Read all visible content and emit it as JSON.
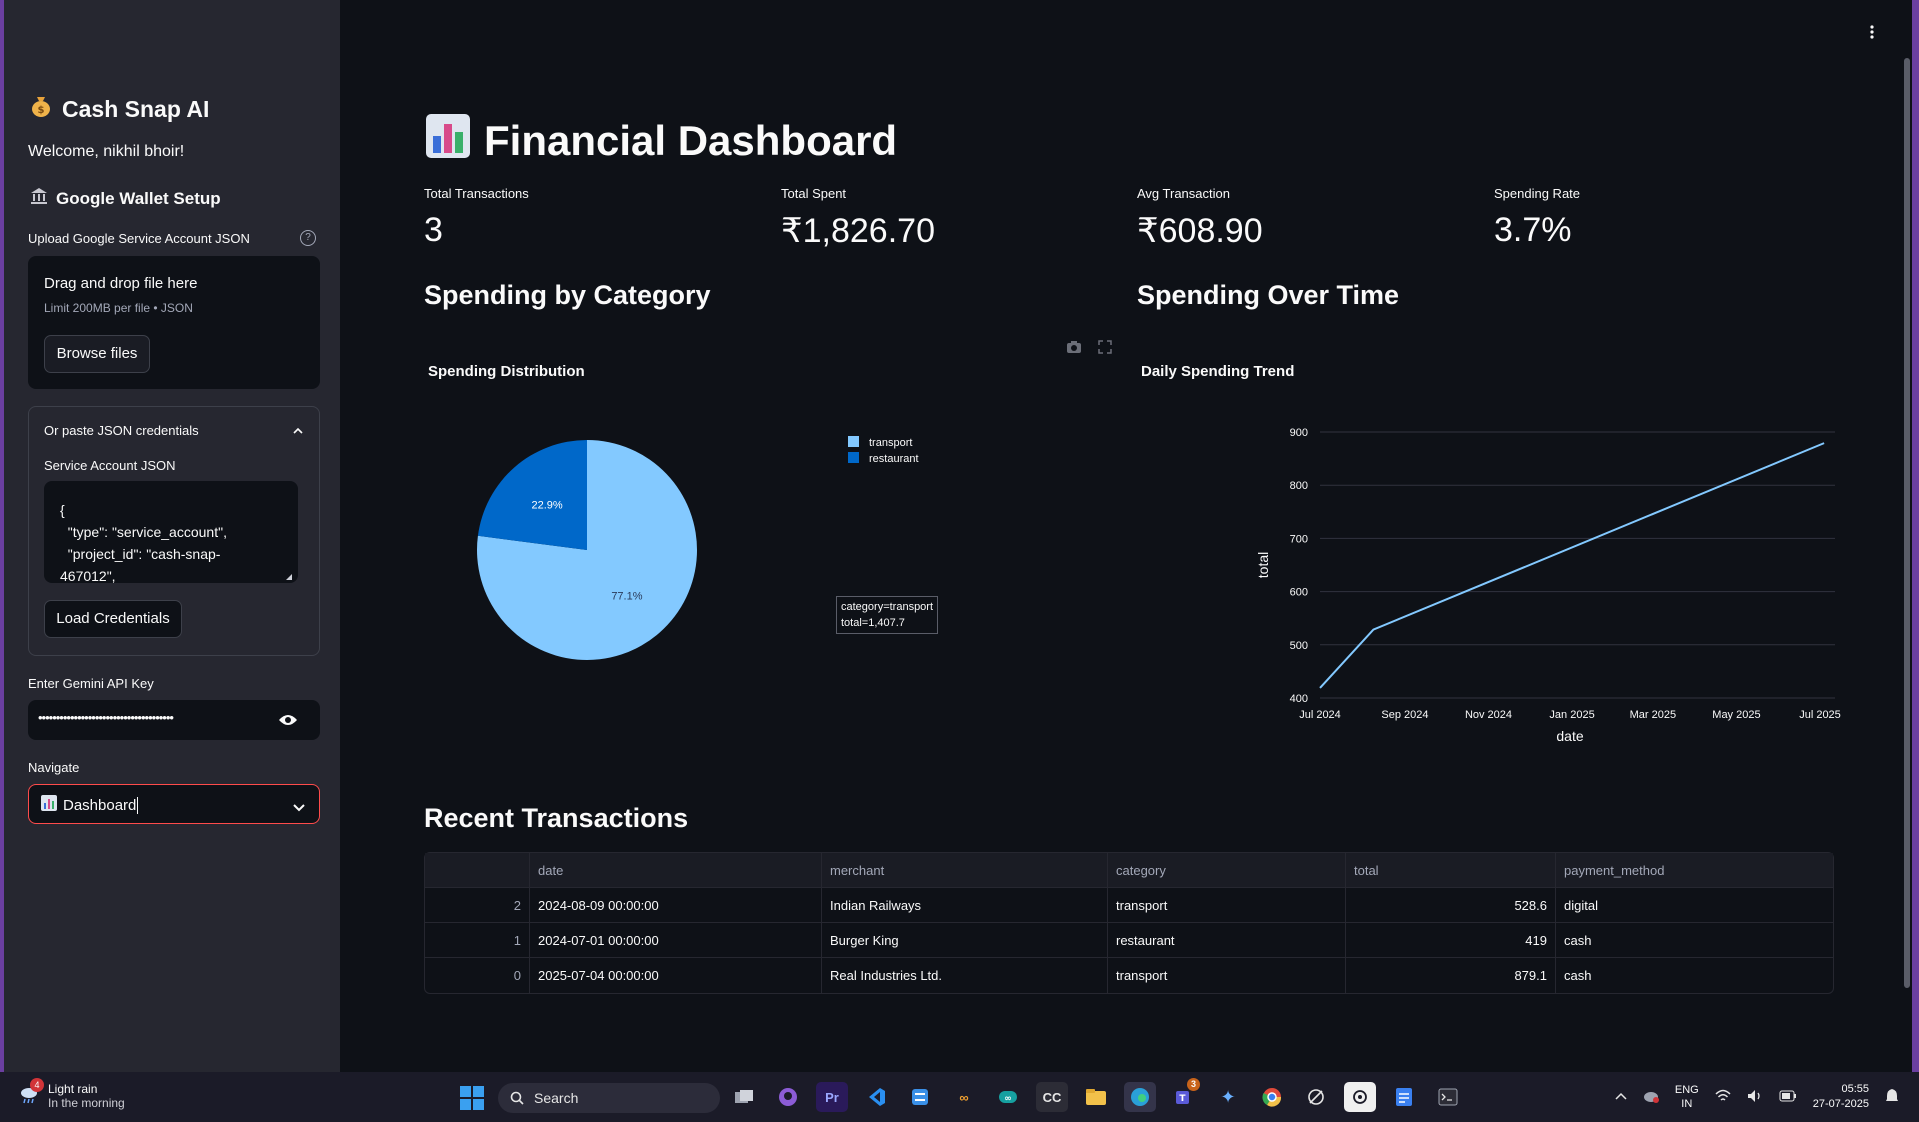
{
  "sidebar": {
    "title": "Cash Snap AI",
    "welcome": "Welcome, nikhil bhoir!",
    "wallet_heading": "Google Wallet Setup",
    "upload_label": "Upload Google Service Account JSON",
    "dropzone_title": "Drag and drop file here",
    "dropzone_limit": "Limit 200MB per file • JSON",
    "browse_label": "Browse files",
    "expander_label": "Or paste JSON credentials",
    "json_label": "Service Account JSON",
    "json_value": "{\n  \"type\": \"service_account\",\n  \"project_id\": \"cash-snap-\n467012\",",
    "load_label": "Load Credentials",
    "api_label": "Enter Gemini API Key",
    "api_value": "••••••••••••••••••••••••••••••••••••••",
    "nav_label": "Navigate",
    "nav_value": "Dashboard"
  },
  "main": {
    "title": "Financial Dashboard",
    "metrics": [
      {
        "label": "Total Transactions",
        "value": "3"
      },
      {
        "label": "Total Spent",
        "value": "₹1,826.70"
      },
      {
        "label": "Avg Transaction",
        "value": "₹608.90"
      },
      {
        "label": "Spending Rate",
        "value": "3.7%"
      }
    ],
    "section_category": "Spending by Category",
    "section_time": "Spending Over Time",
    "section_recent": "Recent Transactions",
    "tooltip_line1": "category=transport",
    "tooltip_line2": "total=1,407.7"
  },
  "chart_data": [
    {
      "type": "pie",
      "title": "Spending Distribution",
      "labels": [
        "transport",
        "restaurant"
      ],
      "values": [
        1407.7,
        419
      ],
      "percent_labels": [
        "77.1%",
        "22.9%"
      ],
      "colors": [
        "#83c9ff",
        "#0068c9"
      ],
      "legend": "top-right"
    },
    {
      "type": "line",
      "title": "Daily Spending Trend",
      "xlabel": "date",
      "ylabel": "total",
      "x": [
        "2024-07-01",
        "2024-08-09",
        "2025-07-04"
      ],
      "y": [
        419,
        528.6,
        879.1
      ],
      "xticks": [
        "Jul 2024",
        "Sep 2024",
        "Nov 2024",
        "Jan 2025",
        "Mar 2025",
        "May 2025",
        "Jul 2025"
      ],
      "yticks": [
        400,
        500,
        600,
        700,
        800,
        900
      ],
      "ylim": [
        400,
        900
      ],
      "color": "#83c9ff",
      "grid": true
    }
  ],
  "table": {
    "columns": [
      "",
      "date",
      "merchant",
      "category",
      "total",
      "payment_method"
    ],
    "rows": [
      {
        "idx": "2",
        "date": "2024-08-09 00:00:00",
        "merchant": "Indian Railways",
        "category": "transport",
        "total": "528.6",
        "payment_method": "digital"
      },
      {
        "idx": "1",
        "date": "2024-07-01 00:00:00",
        "merchant": "Burger King",
        "category": "restaurant",
        "total": "419",
        "payment_method": "cash"
      },
      {
        "idx": "0",
        "date": "2025-07-04 00:00:00",
        "merchant": "Real Industries Ltd.",
        "category": "transport",
        "total": "879.1",
        "payment_method": "cash"
      }
    ]
  },
  "taskbar": {
    "weather_badge": "4",
    "weather_line1": "Light rain",
    "weather_line2": "In the morning",
    "search_label": "Search",
    "apps": [
      "files",
      "github",
      "Pr",
      "vscode",
      "azure",
      "oo",
      "arduino",
      "CC",
      "explorer",
      "edge",
      "teams",
      "copilot",
      "chrome",
      "perplexity",
      "chatgpt",
      "docs",
      "terminal"
    ],
    "teams_badge": "3",
    "lang1": "ENG",
    "lang2": "IN",
    "time": "05:55",
    "date": "27-07-2025"
  }
}
